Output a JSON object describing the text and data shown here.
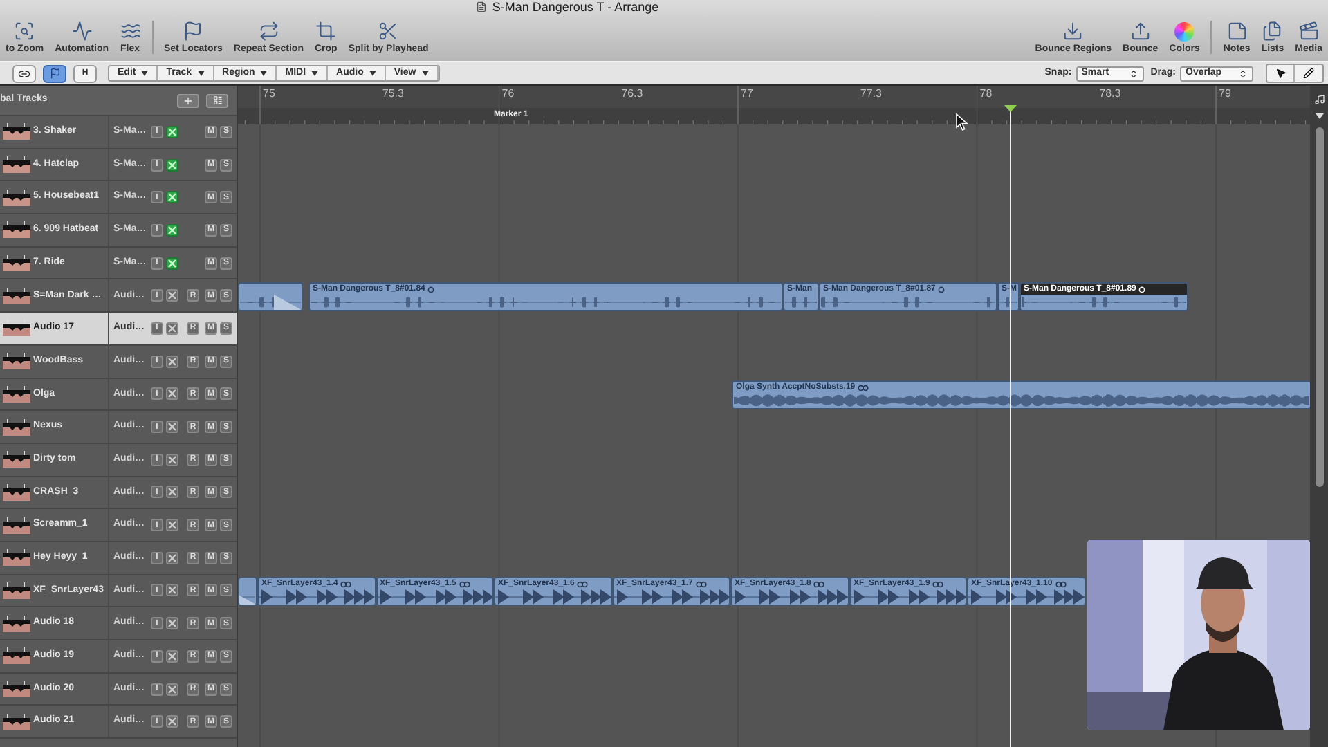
{
  "window": {
    "title": "S-Man Dangerous T - Arrange"
  },
  "toolbar": {
    "left_groups": [
      [
        {
          "kind": "zoom",
          "label": "to Zoom"
        },
        {
          "kind": "automation",
          "label": "Automation"
        },
        {
          "kind": "flex",
          "label": "Flex"
        }
      ],
      [
        {
          "kind": "locators",
          "label": "Set Locators"
        },
        {
          "kind": "repeat",
          "label": "Repeat Section"
        },
        {
          "kind": "crop",
          "label": "Crop"
        },
        {
          "kind": "split",
          "label": "Split by Playhead"
        }
      ]
    ],
    "right_groups": [
      [
        {
          "kind": "bounceregions",
          "label": "Bounce Regions"
        },
        {
          "kind": "bounce",
          "label": "Bounce"
        },
        {
          "kind": "colors",
          "label": "Colors"
        }
      ],
      [
        {
          "kind": "notes",
          "label": "Notes"
        },
        {
          "kind": "lists",
          "label": "Lists"
        },
        {
          "kind": "media",
          "label": "Media"
        }
      ]
    ]
  },
  "edit_bar": {
    "toggles": [
      {
        "kind": "link",
        "on": false
      },
      {
        "kind": "flag",
        "on": true
      },
      {
        "kind": "letter",
        "label": "H",
        "on": false
      }
    ],
    "menus": [
      "Edit",
      "Track",
      "Region",
      "MIDI",
      "Audio",
      "View"
    ],
    "snap": {
      "label": "Snap:",
      "value": "Smart"
    },
    "drag": {
      "label": "Drag:",
      "value": "Overlap"
    }
  },
  "track_list": {
    "header": "bal Tracks"
  },
  "ruler": {
    "labels": [
      "75",
      "75.3",
      "76",
      "76.3",
      "77",
      "77.3",
      "78",
      "78.3",
      "79"
    ],
    "marker": "Marker 1"
  },
  "tracks": [
    {
      "name": "3. Shaker",
      "type": "S-Ma…",
      "kind": "midi",
      "selected": false,
      "input": "I",
      "mute": "M",
      "solo": "S"
    },
    {
      "name": "4. Hatclap",
      "type": "S-Ma…",
      "kind": "midi",
      "selected": false,
      "input": "I",
      "mute": "M",
      "solo": "S"
    },
    {
      "name": "5. Housebeat1",
      "type": "S-Ma…",
      "kind": "midi",
      "selected": false,
      "input": "I",
      "mute": "M",
      "solo": "S"
    },
    {
      "name": "6. 909 Hatbeat",
      "type": "S-Ma…",
      "kind": "midi",
      "selected": false,
      "input": "I",
      "mute": "M",
      "solo": "S"
    },
    {
      "name": "7. Ride",
      "type": "S-Ma…",
      "kind": "midi",
      "selected": false,
      "input": "I",
      "mute": "M",
      "solo": "S"
    },
    {
      "name": "S=Man Dark …",
      "type": "Audi…",
      "kind": "audio",
      "selected": false,
      "input": "I",
      "record": "R",
      "mute": "M",
      "solo": "S",
      "regions": [
        {
          "kind": "fragment",
          "selected": false
        },
        {
          "kind": "wave",
          "label": "S-Man Dangerous T_8#01.84",
          "selected": false
        },
        {
          "kind": "wave",
          "label": "S-Man",
          "selected": false
        },
        {
          "kind": "wave",
          "label": "S-Man Dangerous T_8#01.87",
          "selected": false
        },
        {
          "kind": "wave",
          "label": "S-M",
          "selected": false
        },
        {
          "kind": "wave",
          "label": "S-Man Dangerous T_8#01.89",
          "selected": true
        }
      ]
    },
    {
      "name": "Audio 17",
      "type": "Audi…",
      "kind": "audio",
      "selected": true,
      "input": "I",
      "record": "R",
      "mute": "M",
      "solo": "S"
    },
    {
      "name": "WoodBass",
      "type": "Audi…",
      "kind": "audio",
      "selected": false,
      "input": "I",
      "record": "R",
      "mute": "M",
      "solo": "S"
    },
    {
      "name": "Olga",
      "type": "Audi…",
      "kind": "audio",
      "selected": false,
      "input": "I",
      "record": "R",
      "mute": "M",
      "solo": "S",
      "regions": [
        {
          "kind": "loop",
          "label": "Olga Synth AccptNoSubsts.19",
          "selected": false
        }
      ]
    },
    {
      "name": "Nexus",
      "type": "Audi…",
      "kind": "audio",
      "selected": false,
      "input": "I",
      "record": "R",
      "mute": "M",
      "solo": "S"
    },
    {
      "name": "Dirty tom",
      "type": "Audi…",
      "kind": "audio",
      "selected": false,
      "input": "I",
      "record": "R",
      "mute": "M",
      "solo": "S"
    },
    {
      "name": "CRASH_3",
      "type": "Audi…",
      "kind": "audio",
      "selected": false,
      "input": "I",
      "record": "R",
      "mute": "M",
      "solo": "S"
    },
    {
      "name": "Screamm_1",
      "type": "Audi…",
      "kind": "audio",
      "selected": false,
      "input": "I",
      "record": "R",
      "mute": "M",
      "solo": "S"
    },
    {
      "name": "Hey Heyy_1",
      "type": "Audi…",
      "kind": "audio",
      "selected": false,
      "input": "I",
      "record": "R",
      "mute": "M",
      "solo": "S"
    },
    {
      "name": "XF_SnrLayer43",
      "type": "Audi…",
      "kind": "audio",
      "selected": false,
      "input": "I",
      "record": "R",
      "mute": "M",
      "solo": "S",
      "regions": [
        {
          "kind": "fragment",
          "selected": false
        },
        {
          "kind": "beats",
          "label": "XF_SnrLayer43_1.4",
          "selected": false
        },
        {
          "kind": "beats",
          "label": "XF_SnrLayer43_1.5",
          "selected": false
        },
        {
          "kind": "beats",
          "label": "XF_SnrLayer43_1.6",
          "selected": false
        },
        {
          "kind": "beats",
          "label": "XF_SnrLayer43_1.7",
          "selected": false
        },
        {
          "kind": "beats",
          "label": "XF_SnrLayer43_1.8",
          "selected": false
        },
        {
          "kind": "beats",
          "label": "XF_SnrLayer43_1.9",
          "selected": false
        },
        {
          "kind": "beats",
          "label": "XF_SnrLayer43_1.10",
          "selected": false
        }
      ]
    },
    {
      "name": "Audio 18",
      "type": "Audi…",
      "kind": "audio",
      "selected": false,
      "input": "I",
      "record": "R",
      "mute": "M",
      "solo": "S"
    },
    {
      "name": "Audio 19",
      "type": "Audi…",
      "kind": "audio",
      "selected": false,
      "input": "I",
      "record": "R",
      "mute": "M",
      "solo": "S"
    },
    {
      "name": "Audio 20",
      "type": "Audi…",
      "kind": "audio",
      "selected": false,
      "input": "I",
      "record": "R",
      "mute": "M",
      "solo": "S"
    },
    {
      "name": "Audio 21",
      "type": "Audi…",
      "kind": "audio",
      "selected": false,
      "input": "I",
      "record": "R",
      "mute": "M",
      "solo": "S"
    }
  ]
}
